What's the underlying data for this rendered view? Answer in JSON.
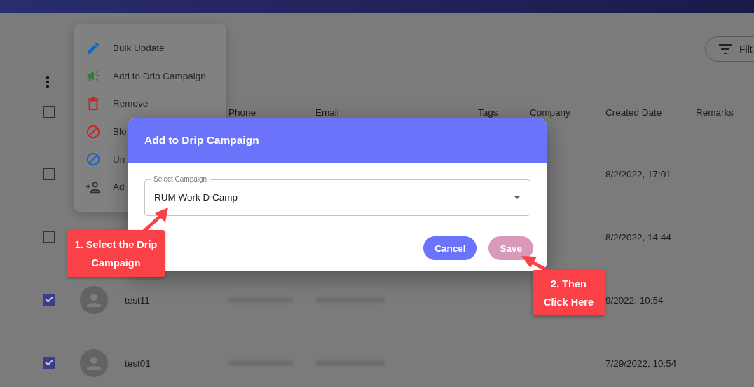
{
  "filter_button": {
    "label": "Filt"
  },
  "table": {
    "columns": [
      "Phone",
      "Email",
      "Tags",
      "Company",
      "Created Date",
      "Remarks"
    ],
    "header_checked": false,
    "rows": [
      {
        "checked": false,
        "avatar": false,
        "blurred_contact": false,
        "created": "8/2/2022, 17:01"
      },
      {
        "checked": false,
        "avatar": false,
        "blurred_contact": false,
        "created": "8/2/2022, 14:44"
      },
      {
        "checked": true,
        "avatar": true,
        "name": "test11",
        "blurred_contact": true,
        "created": "9/2022, 10:54"
      },
      {
        "checked": true,
        "avatar": true,
        "name": "test01",
        "blurred_contact": true,
        "created": "7/29/2022, 10:54"
      }
    ]
  },
  "menu": {
    "items": [
      {
        "label": "Bulk Update",
        "kind": "pencil",
        "color": "#1565c0"
      },
      {
        "label": "Add to Drip Campaign",
        "kind": "megaphone",
        "color": "#2e7d32"
      },
      {
        "label": "Remove",
        "kind": "trash",
        "color": "#c62828"
      },
      {
        "label": "Blo",
        "kind": "block",
        "color": "#c62828"
      },
      {
        "label": "Un",
        "kind": "block",
        "color": "#1565c0"
      },
      {
        "label": "Ad",
        "kind": "personadd",
        "color": "#333333"
      }
    ]
  },
  "dialog": {
    "title": "Add to Drip Campaign",
    "field_label": "Select Campaign",
    "field_value": "RUM Work D Camp",
    "buttons": [
      {
        "label": "Cancel",
        "kind": "primary"
      },
      {
        "label": "Save",
        "kind": "save"
      }
    ]
  },
  "callouts": [
    {
      "text": "1. Select the Drip Campaign"
    },
    {
      "text": "2. Then Click Here"
    }
  ]
}
